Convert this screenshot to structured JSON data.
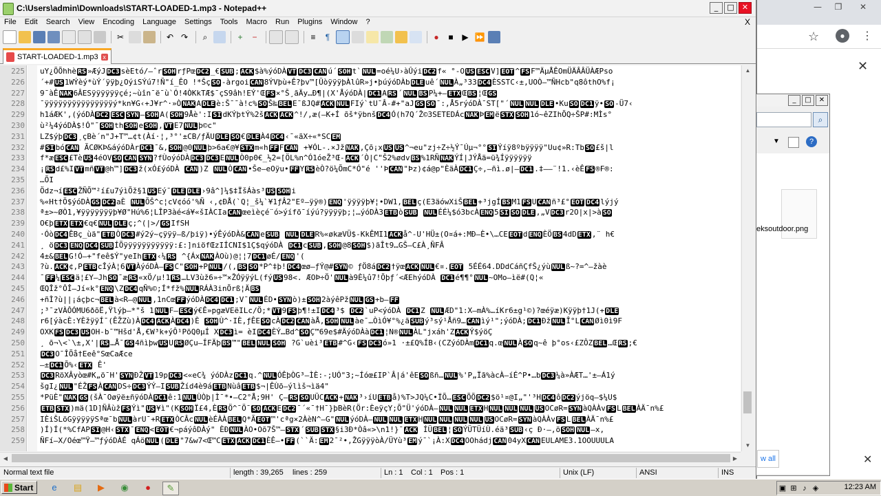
{
  "window": {
    "title": "C:\\Users\\admin\\Downloads\\START-LOADED-1.mp3 - Notepad++",
    "minimize": "_",
    "maximize": "□",
    "close": "✕"
  },
  "menu": {
    "items": [
      "File",
      "Edit",
      "Search",
      "View",
      "Encoding",
      "Language",
      "Settings",
      "Tools",
      "Macro",
      "Run",
      "Plugins",
      "Window",
      "?"
    ],
    "close": "X"
  },
  "toolbar": {
    "icons": [
      "new-file-icon",
      "open-file-icon",
      "save-icon",
      "save-all-icon",
      "close-icon",
      "close-all-icon",
      "print-icon",
      "cut-icon",
      "copy-icon",
      "paste-icon",
      "undo-icon",
      "redo-icon",
      "find-icon",
      "replace-icon",
      "zoom-in-icon",
      "zoom-out-icon",
      "sync-v-icon",
      "sync-h-icon",
      "word-wrap-icon",
      "show-all-chars-icon",
      "indent-guide-icon",
      "udl-icon",
      "doc-map-icon",
      "function-list-icon",
      "folder-workspace-icon",
      "monitoring-icon",
      "record-macro-icon",
      "stop-record-icon",
      "play-macro-icon",
      "play-multiple-icon",
      "save-macro-icon"
    ]
  },
  "tab": {
    "label": "START-LOADED-1.mp3",
    "close": "x"
  },
  "editor": {
    "lines": [
      {
        "n": "225",
        "t": "uY¿ÕÕhhèRS»ÆýJDC3sèEtó/–ˆrSOHrƒPœDC2_€SUB;ACK$à%ýóDÀVTDC3CANú´SOHt`NUL=oé¼U›àÛýiDC2f« °-OUSESCV]EOT^FSF™ÄµÅÊOmÜÄÂÂÜÀÆPso"
      },
      {
        "n": "226",
        "t": "´+#US1WÝèý*ùÝ´ÿÿþ¿OýiSÝú7!Ñ\"í_ÊO  !*ŠçSO-àrgoiCAN8ÝVþù+Ê?þv™[ÜòÿÿÿþÀlûR»j•þúýóDÀbDLEuê´NULÀ„³33DC4ÈSSTC‹±,UOÒ–™ÑHcb\"q8ôthO%f¡"
      },
      {
        "n": "227",
        "t": "9¯àÊNAK6ÂESÿÿÿÿÿÿçé;~ùîn¯ë¯ù`Ó!4ÒKkTÆ$¯çS9âh!EÝ'ŒFS×°Š¸ãÄy…Ð¶|(X'ÅýóDÀ|DC1ARS´NULBSP¼+–ETXŒBS¦ŒGS"
      },
      {
        "n": "228",
        "t": "¯ÿÿÿÿÿÿÿÿÿÿÿÿÿÿÿý*kn¥G‹+J¥r^·»ÒNAKADLEè:Š¯¯à!c%SOŠ‰BELE¯ßJQ#ACKNULFIý`tU¯Â-#+\"aJGSSO¯:,Å5rýóDÀ¯ST[\"´NULNULDLE•KuSODC1ÿ•SO-Ü7‹"
      },
      {
        "n": "229",
        "t": "h1áÆK',(ýóDÀDC2ESCSYN–SOHA(SOH9Åè':ISIdKÝþtÝ%2šACKACK^!/,æ(–K+Í  õš*ÿbnšDC4Ó(h7Q´Ž©3SETEDÁcNAKÞEMëSTXSOH1ó~êZIhÕQ÷ŠP#:MÌs°"
      },
      {
        "n": "230",
        "t": "ù²¼4ýóDÀ$!Ó\"¯SOHthSOHeSOH,VTE7NULþ©c\""
      },
      {
        "n": "231",
        "t": "LZ$ýþDC3¸çBè´n\"J+T™…¢t(Àí·¦,³°'±CB/ƒÄUDLESO€DLEÀ4DC4‹¯«ãX÷«*SCEM"
      },
      {
        "n": "232",
        "t": "#SIbóCAN ÃCØKÞ&áýóDÀrDC1¯&,SOH@0NULþ>6a€@¥STXm«hFFFCAN    +¥ÓL-.×JžNAK,Çõ¡xUSUS^¬eu\"zj÷Z÷½Ý¯Úµ¬°°SIÝíÿ8ºbÿÿÿÿ\"Uu¢»R:TbSO£š|l"
      },
      {
        "n": "233",
        "t": "f*æESC£TèUS4éOVSOCANSYN?fÙoýóDÀDC3DC3ENULÒ0p0€_½2=[ÖL%n^Ó1óeŽ³Œ-ACK´Ò|C\"Š2%ødvBS%1RÑNAKÝÍ|JÝÅä=ü¾Íÿÿÿÿÿÿ"
      },
      {
        "n": "234",
        "t": "¡RSd£%IVTmñVT@h™]DC3ž(xÓ£ýóDÀ CAN)Z NULÒCAN•Še–eOÿu•FFYRSèÒ?ö¼ÕmC*Ó\"é ''ÞCAN\"Þz)¢á@p\"ÈäÀDC1Ç÷,–ñì.ø|–DC1.‡—–¨!1.‹èÊFS®F®:"
      },
      {
        "n": "235",
        "t": "…ÕI"
      },
      {
        "n": "236",
        "t": "Ödz¬íESCŽÑÕ™²í£u7ýìÕž§1USEý¯DLEDLE›9â^]¼$‡ÏšÁàs³USSOHi"
      },
      {
        "n": "237",
        "t": "%«Ht†Ö$ýóDÀGSDC2aÈ  NULÕŠ^c¦cV¢óó'%Ñ ‹,¢ÐÅ(`Q¦_š¼`¥1ƒÂ2\"Eº–ÿÿ®)ENQ'ÿÿÿÿþ¥¦•DW1,BELç(E3äówXiŠBEL+³jgÍBSM1FSUCANñ³£°EOTDC4lýjý"
      },
      {
        "n": "238",
        "t": "ª±>~ØÒ1,¥ÿÿÿÿÿÿÿþ¥Ø\"Hú%6¦LÎP3àé<á¥«šIÀCIaCANœeìèçé¨ó>ýífõ¯íýú?ÿÿÿÿþ;¦…ýóDÀ3ETBòSUB NULÉÉ¼$ó3bcÀENQ5SISODLE,„VDC3r2O|x|>àSO"
      },
      {
        "n": "239",
        "t": "O€þETXETX€q€NULDLEç;^(|>/GSIfSH"
      },
      {
        "n": "240",
        "t": "·ÓòDC4ÊBç_ùä\"ETBÒDC3#ý2ý~çÿÿÿ–ß/þiÿ)•ýÊýóDÀ&CANeSUB NULDLER%«økæVÜ$-KkÊMI1ACKå^-U'HÜ±(O¤á+:MÐ–È•\\…CEEOTdENQÈÖBS4dDETX,¨ h€"
      },
      {
        "n": "241",
        "t": "¸ öDC3ENQDC4SUBÍÕÿÿÿÿÿÿÿÿÿÿÿ:£:]niöfŒzIÍCNI$1Ç$qýóDÀ DC1cSUB,SOH@8SOH$)ãÎt9…GŠ–C£À¸ÑFÂ"
      },
      {
        "n": "242",
        "t": "4±&BELG!Ó–+\"feê$Ý\"yeIhETX‹¼RS ^{ÁxNAKÀOù)@¦¦7DC1øÉ/ENQ'("
      },
      {
        "n": "243",
        "t": "?ù.ACK¢,PETBcÎýÀ¦6VTÀýóDÀ–FSC\"SOH+PNUL/(,BSSO*P^‡þ!DC4œø–ƒÝ@#SYN©    ƒÖ8áDC2†ÿœACKNUL€¤.EOT 5ÉÉ64.DDdCáñÇfŠ¿ýùNULß~?=^–žàè"
      },
      {
        "n": "244",
        "t": "¯FF¼ESCä¦£Y–JhSO¯æRS«xÖ/µ!1RS…LV3ùž6»÷™×ŽÓÿÿýL(fýUS98<.   ÆOÞ÷Ö'NULà9È¼û7!Õþƒ´<ÆEhýóDÀ    DC1é¶¶°NUL~OMo–ìë#(Q¦«"
      },
      {
        "n": "245",
        "t": "ŒQÎž°ÔÎ–Jí«k°ENQ\\ZDC4qÑ%©;Í*fž%NULRÁÀ3inÕrß¦ÄBS"
      },
      {
        "n": "246",
        "t": "+ñÌ?ù||¡áçþc¬BELà<R–@NUL,1nCœFFýóDÀDC4DC1;V¯NULÉD•SYNò)±SOH2àýêPžNULGS+b–FF"
      },
      {
        "n": "247",
        "t": ";³¯zVÀÔÓMU6ðõË,Ÿlýþ–*\"š 1NULF–ESCý€Ê»pgæVEëILc/Ö;*VT9FSþ¶!±IDC4³$ DC2`uP<ýóDÀ DC1Z NULÆD\"1:X–mÀ%…íKr6±g¹©)?œéÿæ)Kÿÿþ†1J(+DLE"
      },
      {
        "n": "248",
        "t": "r6[ýàcÈ:YÈžÿÿÍ¯(ÊŽZù)ÀDC4ACKÀDC4)È SOHÙ^·IÈ,ƒÊESOcÀDC2CANàÅ,SOHNULàe¯…ÒìÓ¥°%¿ãSUBý³sý¹Åñ9…CANìý¹\";ýóDÀ;DC1ÐžNULÎ°LCANØì0ì9F"
      },
      {
        "n": "249",
        "t": "OXKFSDC3USOH-b¯™Hšd'Å,€W³k+ýÔ¹PõQ0µÍ    XDC3ì= èIDC4ÈÝ…Bd^SOÇ™69e$#ÄýóDÀàDC1¦N®NULÀL\"jxáh'ZACKÝ$ýöÇ"
      },
      {
        "n": "250",
        "t": "¸ õ¬\\<`\\±,X'|RS…Å¯GS4ñìþwUSURSØÇu–ÍFÄþBS™\"BELNULSOH ?G`uèi³ETB#^G‹FSDC3ó»1 ·±£Q%ÍB‹(CZýóDÀmDC1q.œNULÀSOq~ê þ°os‹£ZÔZBEL…ŒRS;€"
      },
      {
        "n": "251",
        "t": "DC3O¯ÎÕå†Eeê°SœCaÆce"
      },
      {
        "n": "252",
        "t": "–±DC1Õ%‹ETX Ê'"
      },
      {
        "n": "253",
        "t": "DC3RöXÂyòœ#K„ö¯H'SYNÐŽVT19pDC3<«eC¾ ýóDÀzDC1q.^NULÓÊþÒG³–ÌÈ:-;UÓ\"3;~Íóœ£IP`Â|á'êESOßñ…NUL%'P„Ïã%àcÀ–íÉ^P•…bDC3¼à»ÀÆT…'±–Á1ý"
      },
      {
        "n": "254",
        "t": "šgI¿NUL\"ÉŽFSÀCANDS÷DC3ÝÝ–ISUBŽíd4è9áETBNùâETB$¬|ÊÙõ–ýlìš¬ìä4\""
      },
      {
        "n": "255",
        "t": "*PüÈ\"NAKGS(šÀ¯Oøÿë±ñÿóDÀDC1ê:1NULÙÒþ|Ì¯*•–C2°Å;9H' Ç–RSSOUÜCACK+NAK³›íUETBå)%T>JQ¼C•ÏÕ…ESCÕÕDC2$ö¹¤@I„\"'³HDC4ôDC2ýjöq–$¼U$"
      },
      {
        "n": "256",
        "t": "ETBSTX)mä(1D]ÑÂùžFSÝì\"US¥ì\"(KSOHÏ£4,ÈRSÖ^¯Ö¯SOACKEDC2¯´«¯†H¯}þBèR(Ör:ÈeÿçY;Õ\"Ü'ýóDÀ–NULNULETXHNULNULNULUSOCøR=SYNàQÀÀvFSLBELÀÄ¯n%£"
      },
      {
        "n": "257",
        "t": "IÈiŠLöGÿÿÿÿÿSªœ¯bNULàrU¯+RETXÒCÂcNULèÉÀÀBELQ*ÃEOT™'cªg×2ÀèN^–G\"NULýóDÀ–NULNULETXHNULNULNULNULUSOCøR=SYNàQÀÀvFSLBELÀÄ¯n%£"
      },
      {
        "n": "258",
        "t": ")Í)Í(*%CfAPSI@H‹STX¯ENQ<EOT€¬páýôDÀý\"  ÈÐNULÀO•Oõ7Š™–STX´SUBSTX§i3Ð*Òâ«>\\n1!}¯ACK ÍÜBEL¦SOÝÜTÜíÙ.éä³SUB‹ç   Ð·–,öSOHNUL–x,"
      },
      {
        "n": "259",
        "t": "ÑFí–X/Oéœ™Ÿ–™ƒýóDÀÉ qÁöNUL(DLE\"7&w7<Œ™CETXACKDC1ÈÊ–•FF(``Ä:EM2¯²•,ŽGÿÿÿòÀ/ÜYù³EMý¯`¡À:XDC4OOhádjCAN04yXCANEULAME3.1OOUUULA"
      }
    ]
  },
  "status": {
    "type": "Normal text file",
    "length": "length : 39,265",
    "lines": "lines : 259",
    "ln": "Ln : 1",
    "col": "Col : 1",
    "pos": "Pos : 1",
    "eol": "Unix (LF)",
    "encoding": "ANSI",
    "mode": "INS"
  },
  "browser": {
    "minimize": "—",
    "maximize": "❐",
    "close": "✕",
    "panel_close": "✕",
    "download_filename": "eksoutdoor.png",
    "show_all": "w all",
    "download_close": "✕"
  },
  "taskbar": {
    "start_label": "Start",
    "clock": "12:23 AM"
  }
}
